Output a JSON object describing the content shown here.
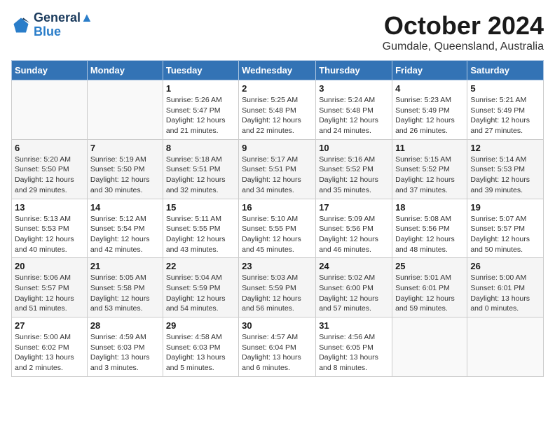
{
  "header": {
    "logo_line1": "General",
    "logo_line2": "Blue",
    "month": "October 2024",
    "location": "Gumdale, Queensland, Australia"
  },
  "weekdays": [
    "Sunday",
    "Monday",
    "Tuesday",
    "Wednesday",
    "Thursday",
    "Friday",
    "Saturday"
  ],
  "weeks": [
    [
      {
        "day": "",
        "detail": ""
      },
      {
        "day": "",
        "detail": ""
      },
      {
        "day": "1",
        "detail": "Sunrise: 5:26 AM\nSunset: 5:47 PM\nDaylight: 12 hours\nand 21 minutes."
      },
      {
        "day": "2",
        "detail": "Sunrise: 5:25 AM\nSunset: 5:48 PM\nDaylight: 12 hours\nand 22 minutes."
      },
      {
        "day": "3",
        "detail": "Sunrise: 5:24 AM\nSunset: 5:48 PM\nDaylight: 12 hours\nand 24 minutes."
      },
      {
        "day": "4",
        "detail": "Sunrise: 5:23 AM\nSunset: 5:49 PM\nDaylight: 12 hours\nand 26 minutes."
      },
      {
        "day": "5",
        "detail": "Sunrise: 5:21 AM\nSunset: 5:49 PM\nDaylight: 12 hours\nand 27 minutes."
      }
    ],
    [
      {
        "day": "6",
        "detail": "Sunrise: 5:20 AM\nSunset: 5:50 PM\nDaylight: 12 hours\nand 29 minutes."
      },
      {
        "day": "7",
        "detail": "Sunrise: 5:19 AM\nSunset: 5:50 PM\nDaylight: 12 hours\nand 30 minutes."
      },
      {
        "day": "8",
        "detail": "Sunrise: 5:18 AM\nSunset: 5:51 PM\nDaylight: 12 hours\nand 32 minutes."
      },
      {
        "day": "9",
        "detail": "Sunrise: 5:17 AM\nSunset: 5:51 PM\nDaylight: 12 hours\nand 34 minutes."
      },
      {
        "day": "10",
        "detail": "Sunrise: 5:16 AM\nSunset: 5:52 PM\nDaylight: 12 hours\nand 35 minutes."
      },
      {
        "day": "11",
        "detail": "Sunrise: 5:15 AM\nSunset: 5:52 PM\nDaylight: 12 hours\nand 37 minutes."
      },
      {
        "day": "12",
        "detail": "Sunrise: 5:14 AM\nSunset: 5:53 PM\nDaylight: 12 hours\nand 39 minutes."
      }
    ],
    [
      {
        "day": "13",
        "detail": "Sunrise: 5:13 AM\nSunset: 5:53 PM\nDaylight: 12 hours\nand 40 minutes."
      },
      {
        "day": "14",
        "detail": "Sunrise: 5:12 AM\nSunset: 5:54 PM\nDaylight: 12 hours\nand 42 minutes."
      },
      {
        "day": "15",
        "detail": "Sunrise: 5:11 AM\nSunset: 5:55 PM\nDaylight: 12 hours\nand 43 minutes."
      },
      {
        "day": "16",
        "detail": "Sunrise: 5:10 AM\nSunset: 5:55 PM\nDaylight: 12 hours\nand 45 minutes."
      },
      {
        "day": "17",
        "detail": "Sunrise: 5:09 AM\nSunset: 5:56 PM\nDaylight: 12 hours\nand 46 minutes."
      },
      {
        "day": "18",
        "detail": "Sunrise: 5:08 AM\nSunset: 5:56 PM\nDaylight: 12 hours\nand 48 minutes."
      },
      {
        "day": "19",
        "detail": "Sunrise: 5:07 AM\nSunset: 5:57 PM\nDaylight: 12 hours\nand 50 minutes."
      }
    ],
    [
      {
        "day": "20",
        "detail": "Sunrise: 5:06 AM\nSunset: 5:57 PM\nDaylight: 12 hours\nand 51 minutes."
      },
      {
        "day": "21",
        "detail": "Sunrise: 5:05 AM\nSunset: 5:58 PM\nDaylight: 12 hours\nand 53 minutes."
      },
      {
        "day": "22",
        "detail": "Sunrise: 5:04 AM\nSunset: 5:59 PM\nDaylight: 12 hours\nand 54 minutes."
      },
      {
        "day": "23",
        "detail": "Sunrise: 5:03 AM\nSunset: 5:59 PM\nDaylight: 12 hours\nand 56 minutes."
      },
      {
        "day": "24",
        "detail": "Sunrise: 5:02 AM\nSunset: 6:00 PM\nDaylight: 12 hours\nand 57 minutes."
      },
      {
        "day": "25",
        "detail": "Sunrise: 5:01 AM\nSunset: 6:01 PM\nDaylight: 12 hours\nand 59 minutes."
      },
      {
        "day": "26",
        "detail": "Sunrise: 5:00 AM\nSunset: 6:01 PM\nDaylight: 13 hours\nand 0 minutes."
      }
    ],
    [
      {
        "day": "27",
        "detail": "Sunrise: 5:00 AM\nSunset: 6:02 PM\nDaylight: 13 hours\nand 2 minutes."
      },
      {
        "day": "28",
        "detail": "Sunrise: 4:59 AM\nSunset: 6:03 PM\nDaylight: 13 hours\nand 3 minutes."
      },
      {
        "day": "29",
        "detail": "Sunrise: 4:58 AM\nSunset: 6:03 PM\nDaylight: 13 hours\nand 5 minutes."
      },
      {
        "day": "30",
        "detail": "Sunrise: 4:57 AM\nSunset: 6:04 PM\nDaylight: 13 hours\nand 6 minutes."
      },
      {
        "day": "31",
        "detail": "Sunrise: 4:56 AM\nSunset: 6:05 PM\nDaylight: 13 hours\nand 8 minutes."
      },
      {
        "day": "",
        "detail": ""
      },
      {
        "day": "",
        "detail": ""
      }
    ]
  ]
}
